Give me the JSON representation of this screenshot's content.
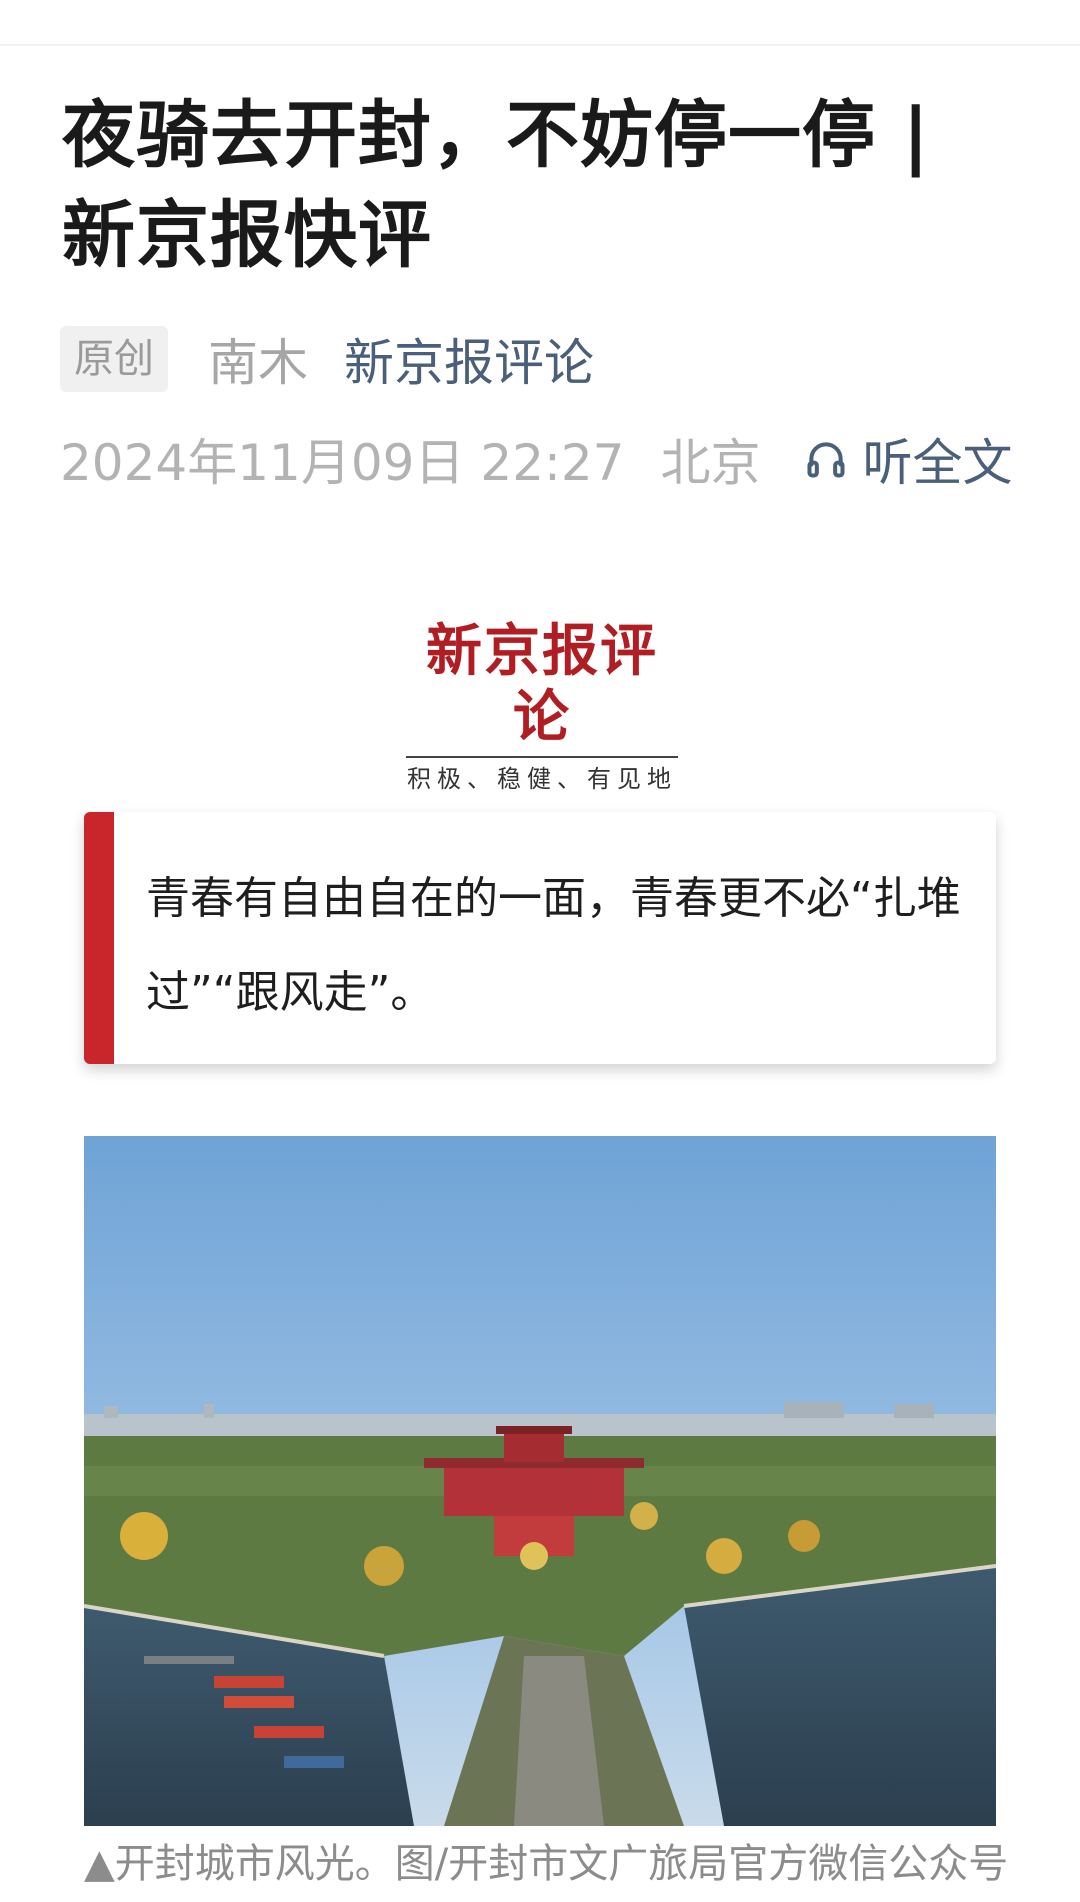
{
  "article": {
    "title": "夜骑去开封，不妨停一停 | 新京报快评",
    "badge": "原创",
    "author": "南木",
    "source": "新京报评论",
    "date": "2024年11月09日 22:27",
    "location": "北京",
    "listen_label": "听全文",
    "listen_icon": "headphones-icon"
  },
  "logo": {
    "name": "新京报评论",
    "slogan": "积极、稳健、有见地",
    "color": "#b01e23"
  },
  "quote": {
    "text": "青春有自由自在的一面，青春更不必“扎堆过”“跟风走”。",
    "accent_color": "#c9262c"
  },
  "image": {
    "caption": "▲开封城市风光。图/开封市文广旅局官方微信公众号"
  }
}
